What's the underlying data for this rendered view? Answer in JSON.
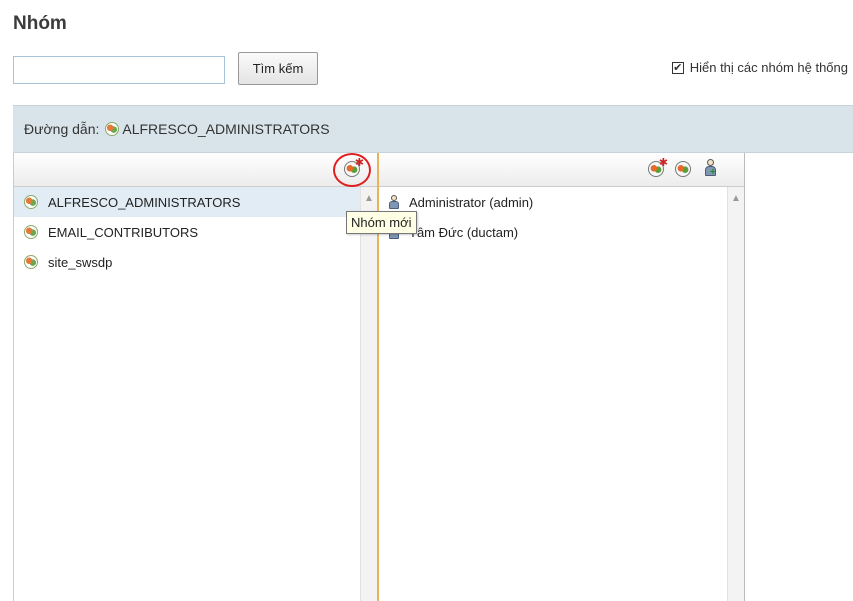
{
  "page": {
    "title": "Nhóm"
  },
  "search": {
    "placeholder": "",
    "value": "",
    "button_label": "Tìm kếm"
  },
  "system_groups": {
    "label": "Hiển thị các nhóm hệ thống",
    "checked": true
  },
  "path": {
    "label": "Đường dẫn:",
    "value": "ALFRESCO_ADMINISTRATORS"
  },
  "groups": [
    {
      "label": "ALFRESCO_ADMINISTRATORS",
      "selected": true
    },
    {
      "label": "EMAIL_CONTRIBUTORS",
      "selected": false
    },
    {
      "label": "site_swsdp",
      "selected": false
    }
  ],
  "members": [
    {
      "label": "Administrator (admin)"
    },
    {
      "label": "Tâm Đức (ductam)"
    }
  ],
  "tooltip": {
    "text": "Nhóm mới"
  },
  "colors": {
    "path_bar": "#d9e4ea",
    "highlight_ring": "#e0201e",
    "panel_divider": "#e8b35a",
    "selected_row": "#e1ecf5"
  }
}
